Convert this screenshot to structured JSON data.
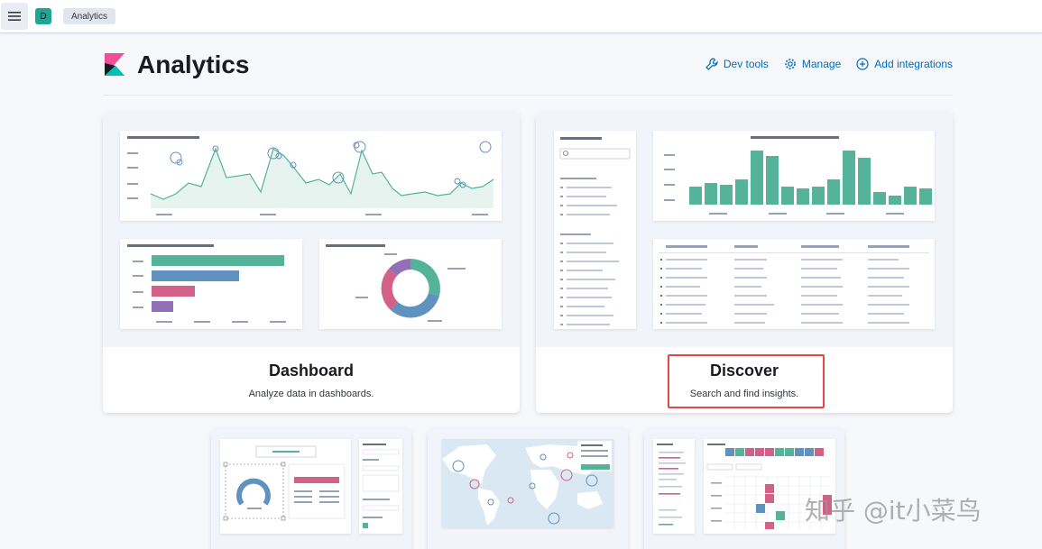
{
  "topbar": {
    "space_initial": "D",
    "breadcrumb": "Analytics"
  },
  "header": {
    "title": "Analytics",
    "actions": [
      {
        "label": "Dev tools",
        "icon": "wrench-icon"
      },
      {
        "label": "Manage",
        "icon": "gear-icon"
      },
      {
        "label": "Add integrations",
        "icon": "plus-circle-icon"
      }
    ]
  },
  "cards": [
    {
      "title": "Dashboard",
      "description": "Analyze data in dashboards."
    },
    {
      "title": "Discover",
      "description": "Search and find insights."
    }
  ],
  "colors": {
    "accent": "#006bb8",
    "green": "#54b399",
    "blue": "#6092c0",
    "pink": "#d36086",
    "purple": "#9170b8",
    "highlight": "#e2474a"
  },
  "watermark": "知乎 @it小菜鸟"
}
